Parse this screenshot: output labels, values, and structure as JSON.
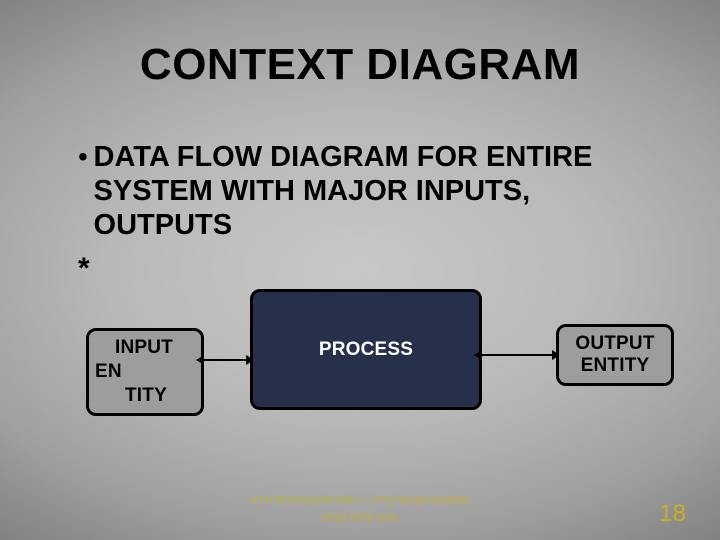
{
  "title": "CONTEXT DIAGRAM",
  "bullet": {
    "dot": "•",
    "text": "DATA FLOW DIAGRAM FOR ENTIRE SYSTEM WITH MAJOR INPUTS, OUTPUTS"
  },
  "asterisk": "*",
  "diagram": {
    "input": {
      "l1": "INPUT",
      "l2": "EN",
      "l3": "TITY"
    },
    "process": "PROCESS",
    "output": {
      "line1": "OUTPUT",
      "line2": "ENTITY"
    }
  },
  "footer": {
    "line1": "מחשבים ומערכות מידע  --  ניתוח ותכנון מערכות מידע",
    "line2": "פרופ' פיליפ הובלין"
  },
  "page_number": "18",
  "chart_data": {
    "type": "diagram",
    "kind": "context-diagram",
    "nodes": [
      {
        "id": "input-entity",
        "label": "INPUT ENTITY",
        "role": "external-entity"
      },
      {
        "id": "process",
        "label": "PROCESS",
        "role": "process"
      },
      {
        "id": "output-entity",
        "label": "OUTPUT ENTITY",
        "role": "external-entity"
      }
    ],
    "edges": [
      {
        "from": "input-entity",
        "to": "process",
        "bidirectional": true
      },
      {
        "from": "process",
        "to": "output-entity",
        "bidirectional": true
      }
    ]
  }
}
